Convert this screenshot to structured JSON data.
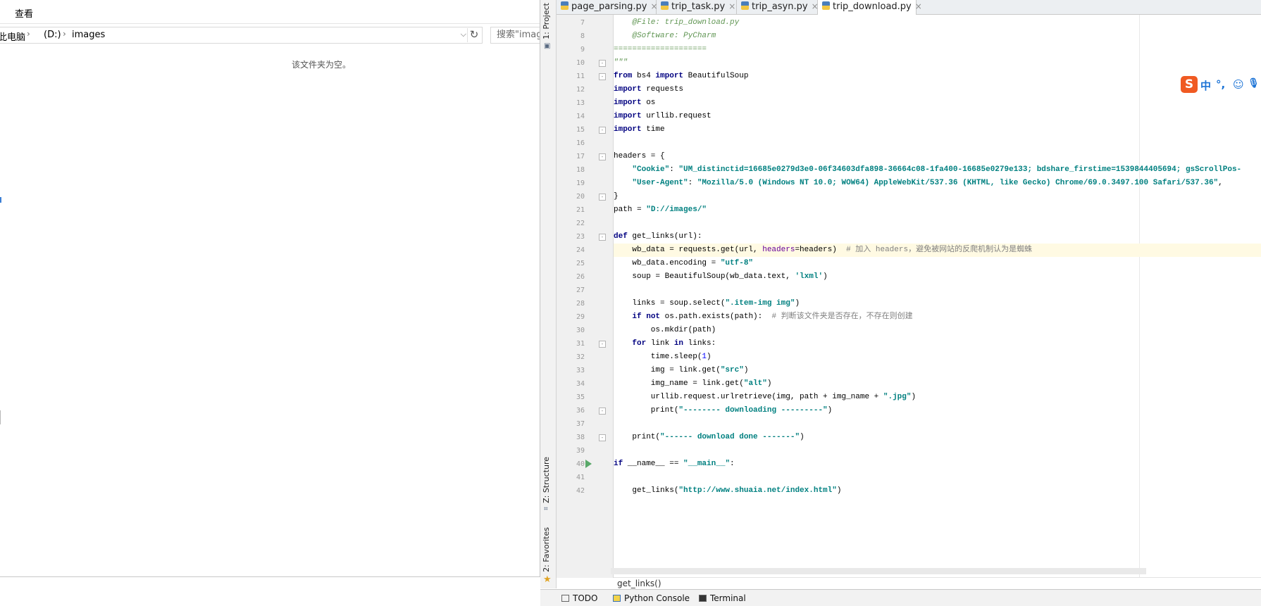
{
  "explorer": {
    "ribbon_tab": "查看",
    "breadcrumbs": [
      "此电脑",
      "(D:)",
      "images"
    ],
    "search_placeholder": "搜索\"images\"",
    "empty_message": "该文件夹为空。"
  },
  "ide": {
    "tool_windows": {
      "project": "1: Project",
      "structure": "Z: Structure",
      "favorites": "2: Favorites"
    },
    "tabs": [
      {
        "label": "page_parsing.py",
        "active": false
      },
      {
        "label": "trip_task.py",
        "active": false
      },
      {
        "label": "trip_asyn.py",
        "active": false
      },
      {
        "label": "trip_download.py",
        "active": true
      }
    ],
    "code_lines": [
      {
        "n": "7",
        "text": "    @File: trip_download.py"
      },
      {
        "n": "8",
        "text": "    @Software: PyCharm"
      },
      {
        "n": "9",
        "text": "===================="
      },
      {
        "n": "10",
        "text": "\"\"\""
      },
      {
        "n": "11",
        "text": "from bs4 import BeautifulSoup"
      },
      {
        "n": "12",
        "text": "import requests"
      },
      {
        "n": "13",
        "text": "import os"
      },
      {
        "n": "14",
        "text": "import urllib.request"
      },
      {
        "n": "15",
        "text": "import time"
      },
      {
        "n": "16",
        "text": ""
      },
      {
        "n": "17",
        "text": "headers = {"
      },
      {
        "n": "18",
        "text": "    \"Cookie\": \"UM_distinctid=16685e0279d3e0-06f34603dfa898-36664c08-1fa400-16685e0279e133; bdshare_firstime=1539844405694; gsScrollPos-"
      },
      {
        "n": "19",
        "text": "    \"User-Agent\": \"Mozilla/5.0 (Windows NT 10.0; WOW64) AppleWebKit/537.36 (KHTML, like Gecko) Chrome/69.0.3497.100 Safari/537.36\","
      },
      {
        "n": "20",
        "text": "}"
      },
      {
        "n": "21",
        "text": "path = \"D://images/\""
      },
      {
        "n": "22",
        "text": ""
      },
      {
        "n": "23",
        "text": "def get_links(url):"
      },
      {
        "n": "24",
        "text": "    wb_data = requests.get(url, headers=headers)  # 加入 headers，避免被网站的反爬机制认为是蜘蛛"
      },
      {
        "n": "25",
        "text": "    wb_data.encoding = \"utf-8\""
      },
      {
        "n": "26",
        "text": "    soup = BeautifulSoup(wb_data.text, 'lxml')"
      },
      {
        "n": "27",
        "text": ""
      },
      {
        "n": "28",
        "text": "    links = soup.select(\".item-img img\")"
      },
      {
        "n": "29",
        "text": "    if not os.path.exists(path):  # 判断该文件夹是否存在，不存在则创建"
      },
      {
        "n": "30",
        "text": "        os.mkdir(path)"
      },
      {
        "n": "31",
        "text": "    for link in links:"
      },
      {
        "n": "32",
        "text": "        time.sleep(1)"
      },
      {
        "n": "33",
        "text": "        img = link.get(\"src\")"
      },
      {
        "n": "34",
        "text": "        img_name = link.get(\"alt\")"
      },
      {
        "n": "35",
        "text": "        urllib.request.urlretrieve(img, path + img_name + \".jpg\")"
      },
      {
        "n": "36",
        "text": "        print(\"-------- downloading ---------\")"
      },
      {
        "n": "37",
        "text": ""
      },
      {
        "n": "38",
        "text": "    print(\"------ download done -------\")"
      },
      {
        "n": "39",
        "text": ""
      },
      {
        "n": "40",
        "text": "if __name__ == \"__main__\":"
      },
      {
        "n": "41",
        "text": ""
      },
      {
        "n": "42",
        "text": "    get_links(\"http://www.shuaia.net/index.html\")"
      }
    ],
    "current_line": "24",
    "breadcrumb": "get_links()",
    "bottom_tools": [
      "TODO",
      "Python Console",
      "Terminal"
    ]
  },
  "ime": {
    "logo": "S",
    "mode": "中",
    "punct": "°,",
    "emoji": "☺",
    "voice": "🎙"
  },
  "colors": {
    "keyword": "#000080",
    "string": "#008080",
    "comment": "#808080",
    "docstring": "#629755",
    "current_line_bg": "#fffae3",
    "ime_brand": "#f05a22"
  }
}
